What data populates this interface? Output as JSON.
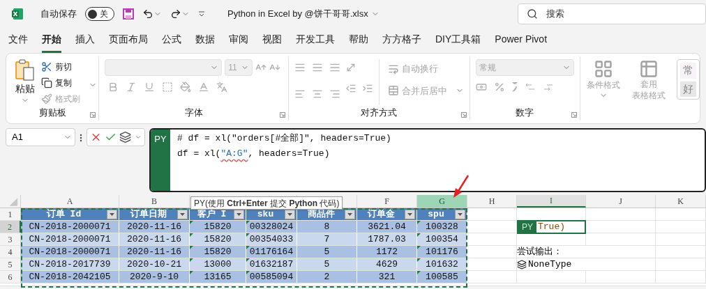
{
  "title_bar": {
    "autosave_label": "自动保存",
    "autosave_on": false,
    "autosave_state": "关",
    "file_name": "Python in Excel by @饼干哥哥.xlsx",
    "search_placeholder": "搜索"
  },
  "menu_tabs": [
    {
      "label": "文件",
      "selected": false
    },
    {
      "label": "开始",
      "selected": true
    },
    {
      "label": "插入",
      "selected": false
    },
    {
      "label": "页面布局",
      "selected": false
    },
    {
      "label": "公式",
      "selected": false
    },
    {
      "label": "数据",
      "selected": false
    },
    {
      "label": "审阅",
      "selected": false
    },
    {
      "label": "视图",
      "selected": false
    },
    {
      "label": "开发工具",
      "selected": false
    },
    {
      "label": "帮助",
      "selected": false
    },
    {
      "label": "方方格子",
      "selected": false
    },
    {
      "label": "DIY工具箱",
      "selected": false
    },
    {
      "label": "Power Pivot",
      "selected": false
    }
  ],
  "ribbon": {
    "clipboard": {
      "label": "剪贴板",
      "paste": "粘贴",
      "cut": {
        "label": "剪切",
        "disabled": false
      },
      "copy": {
        "label": "复制",
        "disabled": false
      },
      "format_painter": {
        "label": "格式刷",
        "disabled": true
      }
    },
    "font": {
      "label": "字体",
      "size": "11",
      "disabled": true
    },
    "alignment": {
      "label": "对齐方式",
      "wrap_text": "自动换行",
      "merge_center": "合并后居中",
      "disabled": true
    },
    "number": {
      "label": "数字",
      "format": "常规",
      "disabled": true
    },
    "styles": {
      "conditional_format": "条件格式",
      "table_format_line1": "套用",
      "table_format_line2": "表格格式",
      "cell_styles": [
        "常",
        "好"
      ],
      "disabled": true
    }
  },
  "formula_bar": {
    "name_box": "A1",
    "prefix": "PY",
    "line1": "# df = xl(\"orders[#全部]\", headers=True)",
    "line2_before": "df = xl(",
    "line2_range": "\"A:G\"",
    "line2_after": ", headers=True)"
  },
  "tooltip": "PY(使用 **Ctrl+Enter** 提交 **Python** 代码)",
  "sheet": {
    "columns": [
      {
        "letter": "A",
        "selected": false,
        "active": false,
        "flagged": false
      },
      {
        "letter": "B",
        "selected": false,
        "active": false,
        "flagged": false
      },
      {
        "selected": false,
        "active": false,
        "flagged": true
      },
      {
        "selected": false,
        "active": false,
        "flagged": true
      },
      {
        "selected": false,
        "active": false,
        "flagged": false
      },
      {
        "letter": "F",
        "selected": false,
        "active": false,
        "flagged": false
      },
      {
        "letter": "G",
        "selected": true,
        "active": false,
        "flagged": true
      },
      {
        "letter": "H",
        "selected": false,
        "active": false
      },
      {
        "letter": "I",
        "selected": false,
        "active": true
      },
      {
        "letter": "J",
        "selected": false,
        "active": false
      },
      {
        "letter": "K",
        "selected": false,
        "active": false
      }
    ],
    "rows": [
      {
        "number": "1",
        "kind": "header",
        "selected": false,
        "cells": [
          "订单 Id",
          "订单日期",
          "客户 I",
          "sku",
          "商品件",
          "订单金",
          "spu"
        ]
      },
      {
        "number": "2",
        "kind": "data",
        "selected": true,
        "cells": [
          "CN-2018-2000071",
          "2020-11-16",
          "15820",
          "00328024",
          "8",
          "3621.04",
          "100328"
        ],
        "extra": {
          "kind": "py_input",
          "badge": "PY",
          "value": "True)"
        }
      },
      {
        "number": "3",
        "kind": "data",
        "selected": false,
        "cells": [
          "CN-2018-2000071",
          "2020-11-16",
          "15820",
          "00354033",
          "7",
          "1787.03",
          "100354"
        ]
      },
      {
        "number": "4",
        "kind": "data",
        "selected": false,
        "cells": [
          "CN-2018-2000071",
          "2020-11-16",
          "15820",
          "01176164",
          "5",
          "1172",
          "101176"
        ],
        "extra": {
          "kind": "text",
          "value": "尝试输出："
        }
      },
      {
        "number": "5",
        "kind": "data",
        "selected": false,
        "cells": [
          "CN-2018-2017739",
          "2020-10-21",
          "13000",
          "01632187",
          "5",
          "4629",
          "101632"
        ],
        "extra": {
          "kind": "type_output",
          "value": "NoneType"
        }
      },
      {
        "number": "6",
        "kind": "data",
        "selected": false,
        "cells": [
          "CN-2018-2042105",
          "2020-9-10",
          "13165",
          "00585094",
          "2",
          "321",
          "100585"
        ]
      }
    ]
  }
}
